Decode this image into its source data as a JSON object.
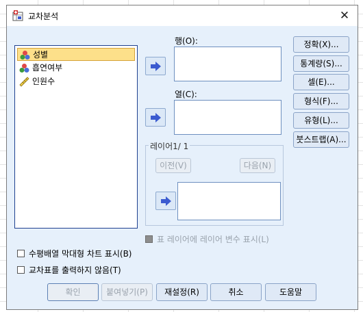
{
  "window": {
    "title": "교차분석",
    "close_glyph": "✕"
  },
  "variables": [
    {
      "label": "성별",
      "icon": "nominal-icon"
    },
    {
      "label": "흡연여부",
      "icon": "nominal-icon"
    },
    {
      "label": "인원수",
      "icon": "scale-icon"
    }
  ],
  "rows_field": {
    "label": "행(O):"
  },
  "cols_field": {
    "label": "열(C):"
  },
  "layer": {
    "label": "레이어1/ 1",
    "prev": "이전(V)",
    "next": "다음(N)"
  },
  "side_buttons": [
    "정확(X)...",
    "통계량(S)...",
    "셀(E)...",
    "형식(F)...",
    "유형(L)...",
    "붓스트랩(A)..."
  ],
  "layer_option": "표 레이어에 레이어 변수 표시(L)",
  "options": [
    "수평배열 막대형 차트 표시(B)",
    "교차표를 출력하지 않음(T)"
  ],
  "bottom_buttons": {
    "ok": "확인",
    "paste": "붙여넣기(P)",
    "reset": "재설정(R)",
    "cancel": "취소",
    "help": "도움말"
  },
  "colors": {
    "dialog_bg": "#e6f0fb",
    "selection": "#fde08a",
    "arrow": "#3b5bd0",
    "border": "#1d3f8f"
  }
}
